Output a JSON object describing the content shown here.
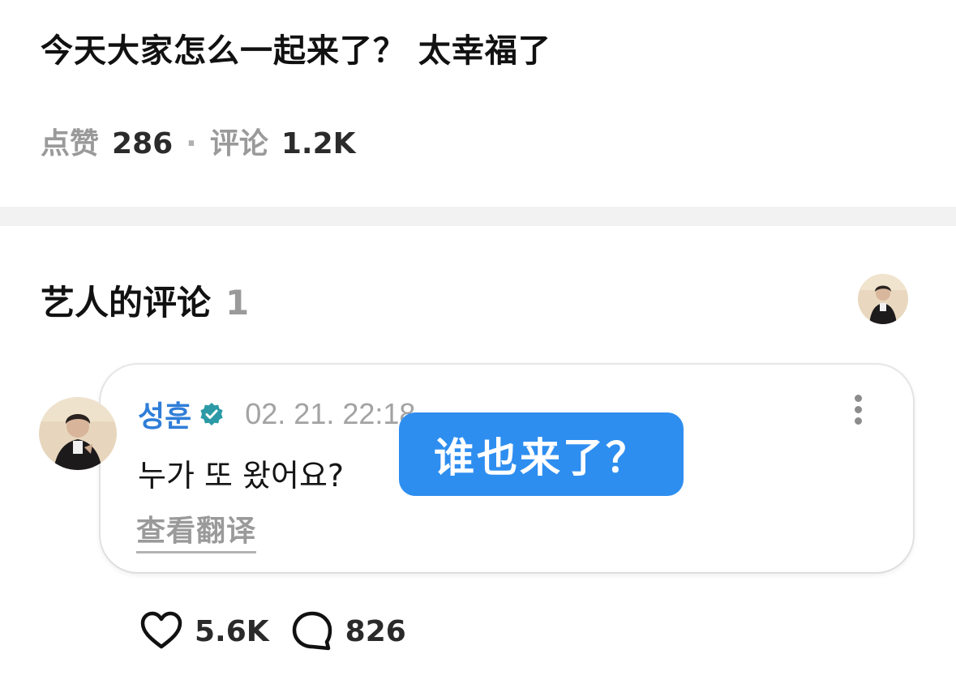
{
  "post": {
    "title": "今天大家怎么一起来了？ 太幸福了",
    "stats": {
      "likes_label": "点赞",
      "likes_count": "286",
      "separator": "·",
      "comments_label": "评论",
      "comments_count": "1.2K"
    }
  },
  "artist_comments": {
    "title": "艺人的评论",
    "count": "1",
    "comment": {
      "author": "성훈",
      "verified_icon": "verified-badge-icon",
      "timestamp": "02. 21. 22:18",
      "text": "누가 또 왔어요?",
      "translate_label": "查看翻译",
      "overlay_translation": "谁也来了？",
      "likes": "5.6K",
      "replies": "826"
    }
  },
  "colors": {
    "author": "#2f7ed8",
    "verified": "#2b9aa6",
    "overlay": "#2e8ef0",
    "muted": "#9a9a9a"
  }
}
